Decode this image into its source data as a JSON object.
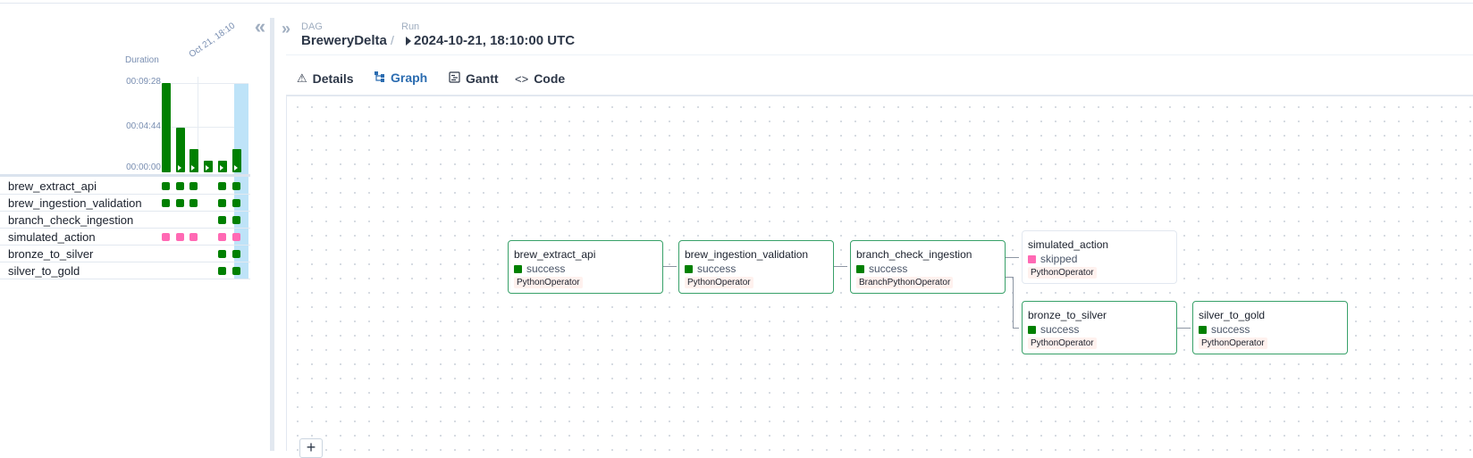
{
  "breadcrumb": {
    "dag_label": "DAG",
    "dag_name": "BreweryDelta",
    "run_label": "Run",
    "run_value": "2024-10-21, 18:10:00 UTC",
    "separator": "/"
  },
  "grid": {
    "duration_label": "Duration",
    "date_label": "Oct 21, 18:10",
    "ticks": [
      "00:09:28",
      "00:04:44",
      "00:00:00"
    ],
    "run_durations_seconds": [
      568,
      284,
      150,
      74,
      74,
      150
    ],
    "tasks": [
      {
        "name": "brew_extract_api",
        "states": [
          "success",
          "success",
          "success",
          "",
          "success",
          "success"
        ]
      },
      {
        "name": "brew_ingestion_validation",
        "states": [
          "success",
          "success",
          "success",
          "",
          "success",
          "success"
        ]
      },
      {
        "name": "branch_check_ingestion",
        "states": [
          "",
          "",
          "",
          "",
          "success",
          "success"
        ]
      },
      {
        "name": "simulated_action",
        "states": [
          "skipped",
          "skipped",
          "skipped",
          "",
          "skipped",
          "skipped"
        ]
      },
      {
        "name": "bronze_to_silver",
        "states": [
          "",
          "",
          "",
          "",
          "success",
          "success"
        ]
      },
      {
        "name": "silver_to_gold",
        "states": [
          "",
          "",
          "",
          "",
          "success",
          "success"
        ]
      }
    ],
    "colors": {
      "success": "#008000",
      "skipped": "#ff69b4",
      "selected_run": "#bee3f8"
    }
  },
  "tabs": [
    {
      "label": "Details",
      "icon": "warning-triangle-icon"
    },
    {
      "label": "Graph",
      "icon": "graph-icon",
      "active": true
    },
    {
      "label": "Gantt",
      "icon": "gantt-icon"
    },
    {
      "label": "Code",
      "icon": "code-icon"
    }
  ],
  "graph": {
    "nodes": [
      {
        "id": "brew_extract_api",
        "title": "brew_extract_api",
        "state": "success",
        "operator": "PythonOperator"
      },
      {
        "id": "brew_ingestion_validation",
        "title": "brew_ingestion_validation",
        "state": "success",
        "operator": "PythonOperator"
      },
      {
        "id": "branch_check_ingestion",
        "title": "branch_check_ingestion",
        "state": "success",
        "operator": "BranchPythonOperator"
      },
      {
        "id": "simulated_action",
        "title": "simulated_action",
        "state": "skipped",
        "operator": "PythonOperator"
      },
      {
        "id": "bronze_to_silver",
        "title": "bronze_to_silver",
        "state": "success",
        "operator": "PythonOperator"
      },
      {
        "id": "silver_to_gold",
        "title": "silver_to_gold",
        "state": "success",
        "operator": "PythonOperator"
      }
    ],
    "zoom_in_label": "+"
  }
}
